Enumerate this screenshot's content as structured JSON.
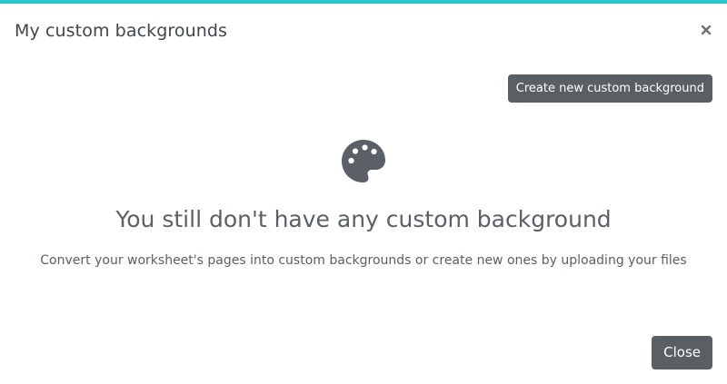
{
  "colors": {
    "accent": "#2bc6cb",
    "button": "#5a5f63",
    "text": "#3e464c",
    "muted_text": "#5a6066"
  },
  "modal": {
    "title": "My custom backgrounds",
    "close_icon": "close-icon",
    "create_button_label": "Create new custom background",
    "empty_state": {
      "icon": "palette-icon",
      "heading": "You still don't have any custom background",
      "description": "Convert your worksheet's pages into custom backgrounds or create new ones by uploading your files"
    },
    "footer": {
      "close_label": "Close"
    }
  }
}
